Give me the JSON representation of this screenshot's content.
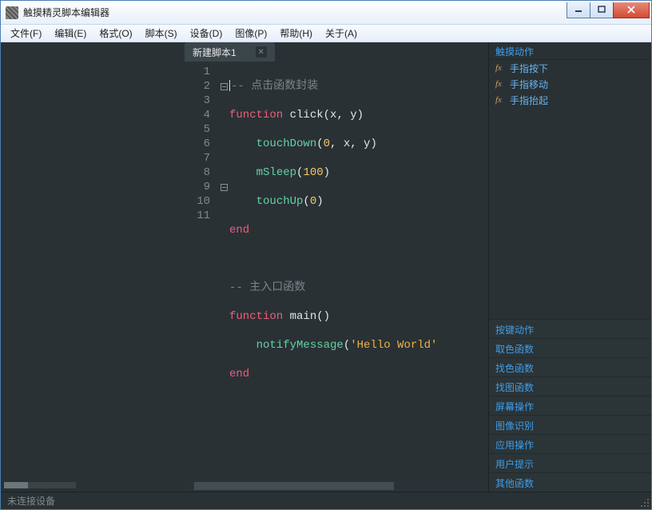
{
  "window": {
    "title": "触摸精灵脚本编辑器"
  },
  "menu": {
    "file": "文件(F)",
    "edit": "编辑(E)",
    "format": "格式(O)",
    "script": "脚本(S)",
    "device": "设备(D)",
    "image": "图像(P)",
    "help": "帮助(H)",
    "about": "关于(A)"
  },
  "tab": {
    "title": "新建脚本1"
  },
  "gutter": [
    "1",
    "2",
    "3",
    "4",
    "5",
    "6",
    "7",
    "8",
    "9",
    "10",
    "11"
  ],
  "code": {
    "l1_comment": "-- 点击函数封装",
    "l2_kw": "function",
    "l2_name": " click",
    "l2_rest": "(x, y)",
    "l3_fn": "touchDown",
    "l3_args": "(",
    "l3_n0": "0",
    "l3_c1": ", x, y)",
    "l4_fn": "mSleep",
    "l4_args": "(",
    "l4_n": "100",
    "l4_close": ")",
    "l5_fn": "touchUp",
    "l5_args": "(",
    "l5_n": "0",
    "l5_close": ")",
    "l6_kw": "end",
    "l8_comment": "-- 主入口函数",
    "l9_kw": "function",
    "l9_name": " main",
    "l9_rest": "()",
    "l10_fn": "notifyMessage",
    "l10_open": "(",
    "l10_str": "'Hello World'",
    "l11_kw": "end"
  },
  "rightPanel": {
    "header": "触摸动作",
    "items": [
      "手指按下",
      "手指移动",
      "手指抬起"
    ],
    "categories": [
      "按键动作",
      "取色函数",
      "找色函数",
      "找图函数",
      "屏幕操作",
      "图像识别",
      "应用操作",
      "用户提示",
      "其他函数"
    ]
  },
  "status": {
    "text": "未连接设备"
  }
}
